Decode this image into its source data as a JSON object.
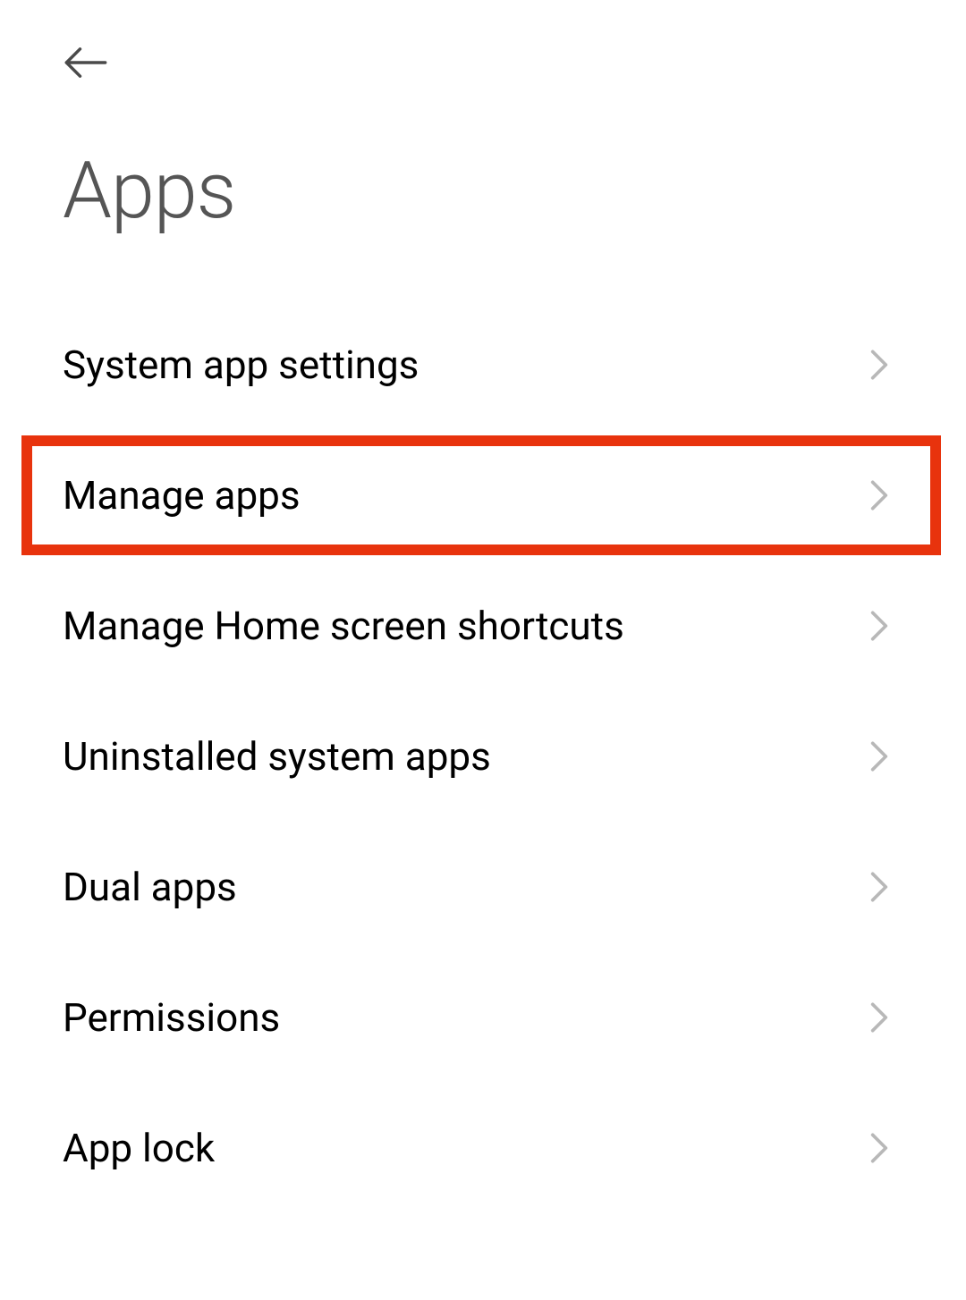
{
  "header": {
    "title": "Apps"
  },
  "menu": {
    "items": [
      {
        "label": "System app settings",
        "highlighted": false
      },
      {
        "label": "Manage apps",
        "highlighted": true
      },
      {
        "label": "Manage Home screen shortcuts",
        "highlighted": false
      },
      {
        "label": "Uninstalled system apps",
        "highlighted": false
      },
      {
        "label": "Dual apps",
        "highlighted": false
      },
      {
        "label": "Permissions",
        "highlighted": false
      },
      {
        "label": "App lock",
        "highlighted": false
      }
    ]
  }
}
